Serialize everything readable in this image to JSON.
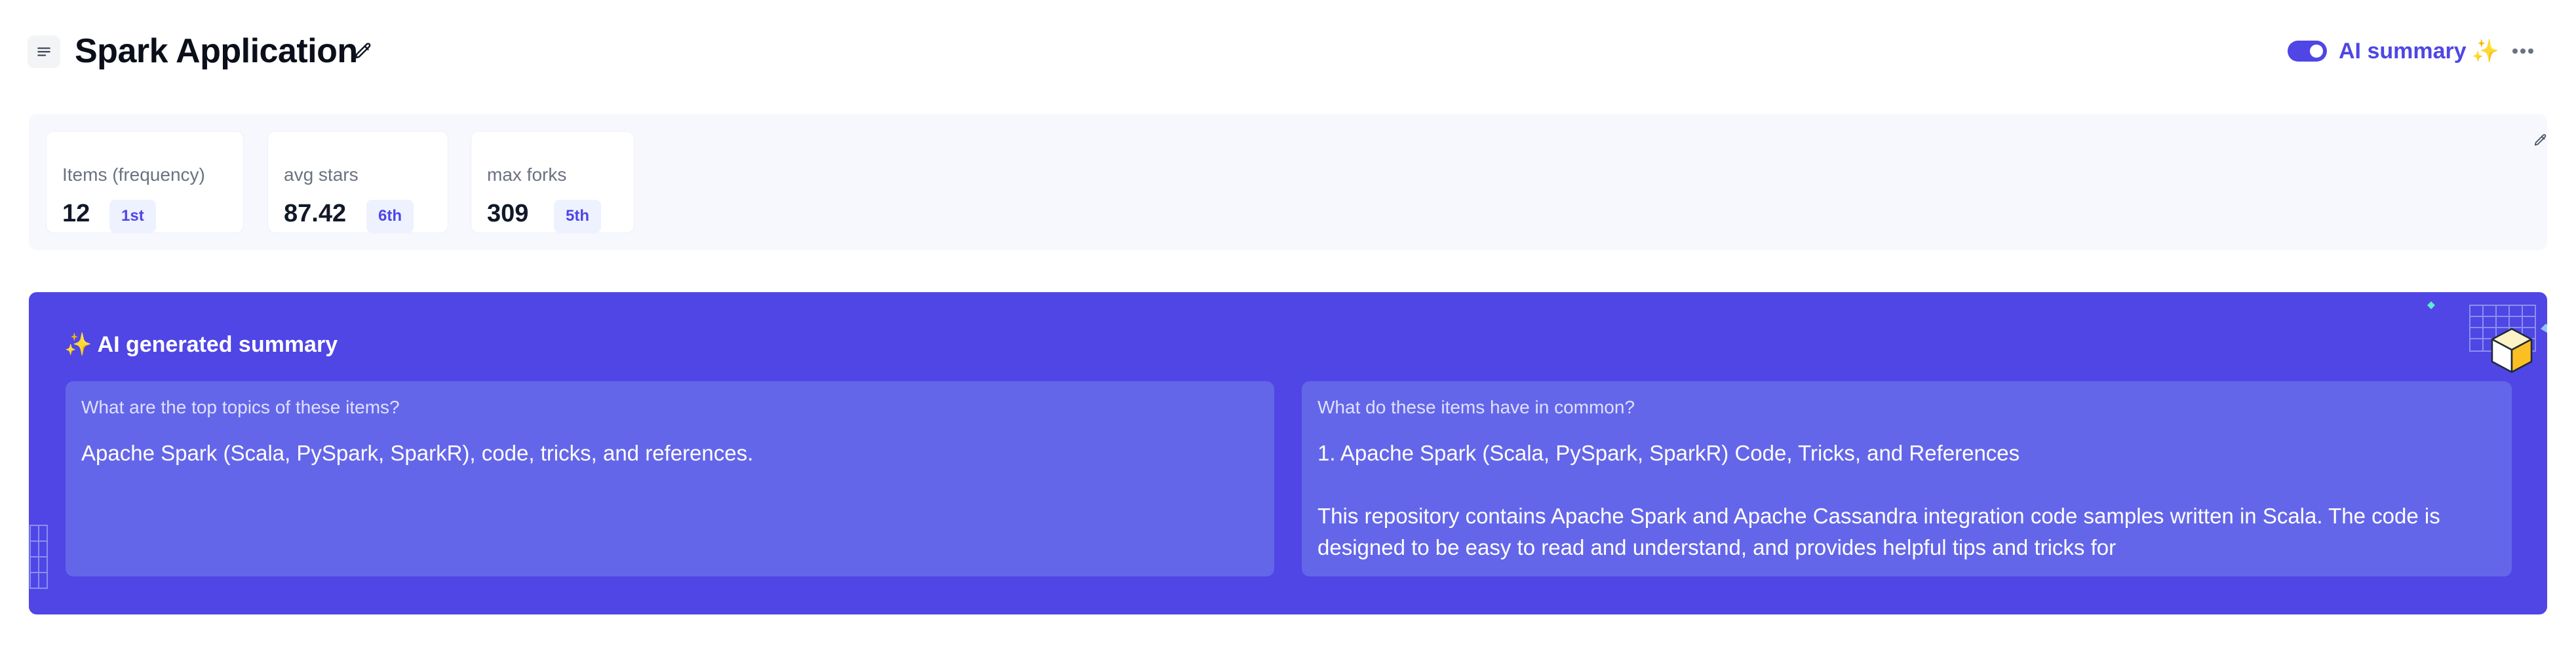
{
  "header": {
    "title": "Spark Application",
    "ai_summary_label": "AI summary",
    "ai_summary_sparkle": "✨",
    "ai_summary_enabled": true,
    "icons": {
      "menu": "menu-lines-icon",
      "edit": "pencil-icon",
      "more": "more-horizontal-icon"
    }
  },
  "stats": [
    {
      "label": "Items (frequency)",
      "value": "12",
      "rank": "1st"
    },
    {
      "label": "avg stars",
      "value": "87.42",
      "rank": "6th"
    },
    {
      "label": "max forks",
      "value": "309",
      "rank": "5th"
    }
  ],
  "ai_summary": {
    "heading_icon": "✨",
    "heading": "AI generated summary",
    "cards": [
      {
        "question": "What are the top topics of these items?",
        "answer_lines": [
          "Apache Spark (Scala, PySpark, SparkR), code, tricks, and references."
        ]
      },
      {
        "question": "What do these items have in common?",
        "answer_lines": [
          "1. Apache Spark (Scala, PySpark, SparkR) Code, Tricks, and References",
          "This repository contains Apache Spark and Apache Cassandra integration code samples written in Scala. The code is designed to be easy to read and understand, and provides helpful tips and tricks for"
        ]
      }
    ]
  },
  "colors": {
    "accent": "#4f46e5",
    "card": "#6466e9",
    "panel_bg": "#f7f8fd",
    "badge_bg": "#eef2ff"
  }
}
